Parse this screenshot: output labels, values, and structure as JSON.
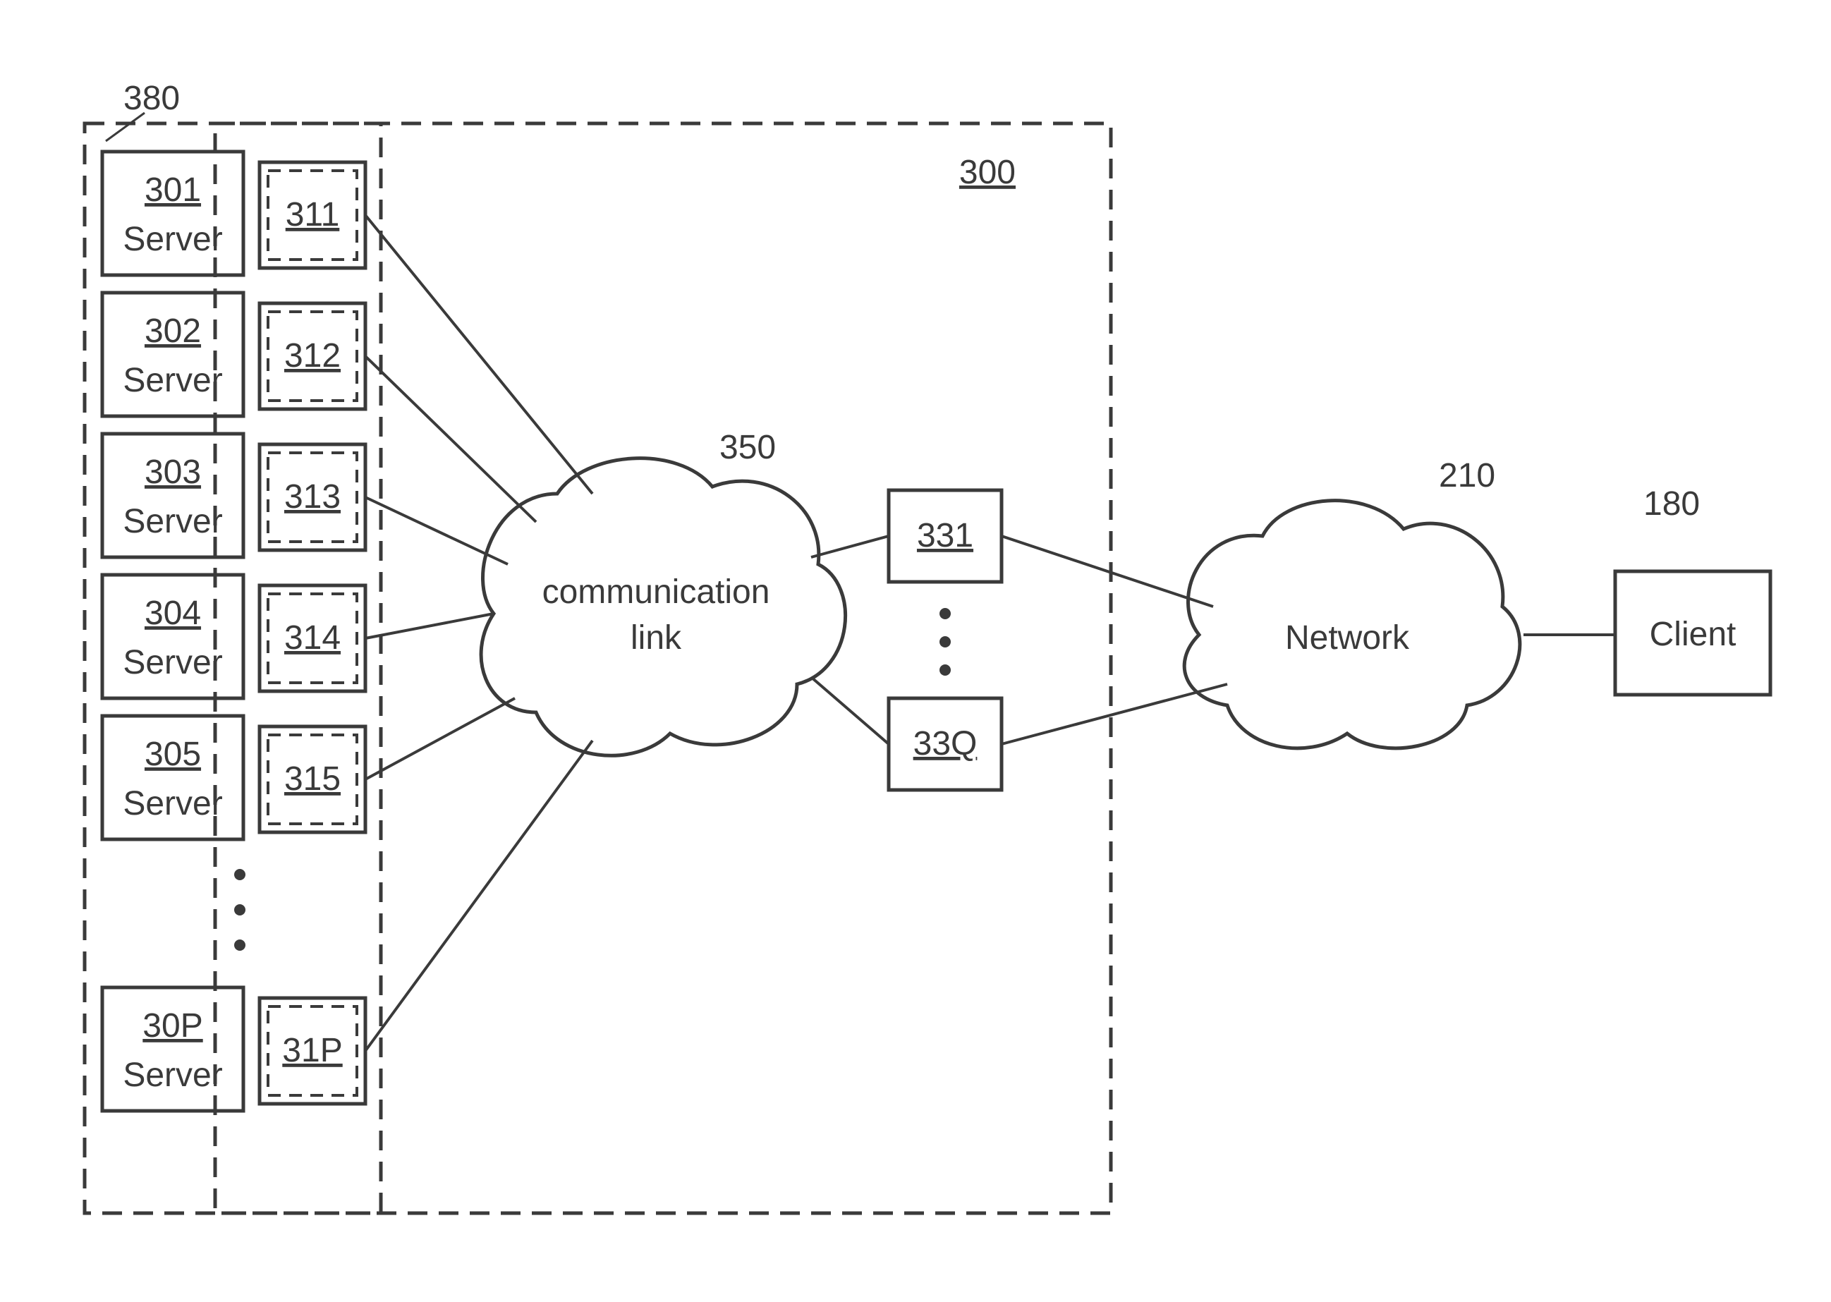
{
  "diagram": {
    "outer_group_ref": "380",
    "main_system_ref": "300",
    "servers": [
      {
        "ref": "301",
        "label": "Server",
        "port_ref": "311"
      },
      {
        "ref": "302",
        "label": "Server",
        "port_ref": "312"
      },
      {
        "ref": "303",
        "label": "Server",
        "port_ref": "313"
      },
      {
        "ref": "304",
        "label": "Server",
        "port_ref": "314"
      },
      {
        "ref": "305",
        "label": "Server",
        "port_ref": "315"
      },
      {
        "ref": "30P",
        "label": "Server",
        "port_ref": "31P"
      }
    ],
    "comm_link": {
      "ref": "350",
      "label_line1": "communication",
      "label_line2": "link"
    },
    "mid_boxes": {
      "top_ref": "331",
      "bottom_ref": "33Q"
    },
    "network": {
      "ref": "210",
      "label": "Network"
    },
    "client": {
      "ref": "180",
      "label": "Client"
    }
  }
}
